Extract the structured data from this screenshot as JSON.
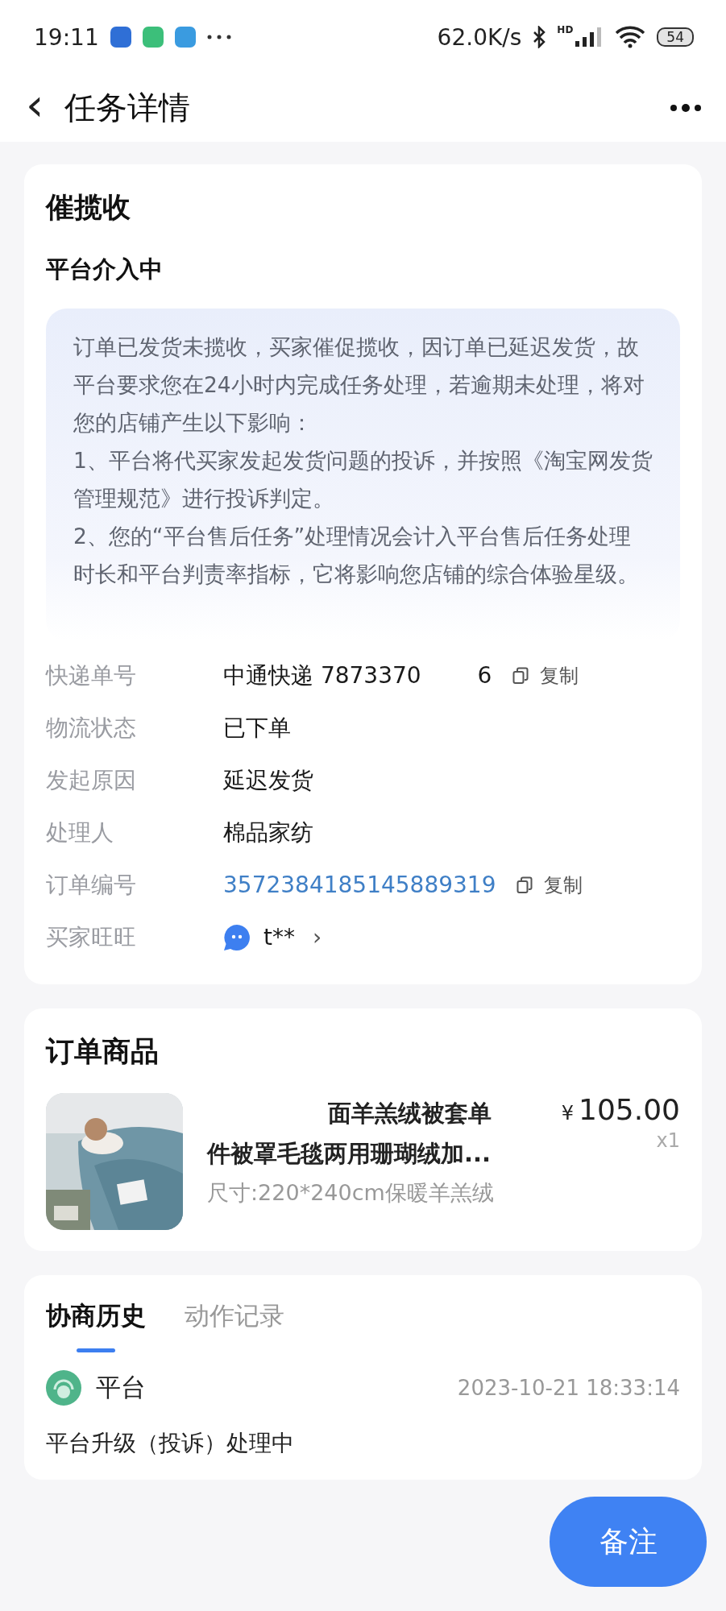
{
  "status_bar": {
    "time": "19:11",
    "speed": "62.0K/s",
    "network_label": "HD",
    "battery": "54"
  },
  "header": {
    "back": "‹",
    "title": "任务详情"
  },
  "task": {
    "title": "催揽收",
    "status": "平台介入中",
    "notice": [
      "订单已发货未揽收，买家催促揽收，因订单已延迟发货，故平台要求您在24小时内完成任务处理，若逾期未处理，将对您的店铺产生以下影响：",
      "1、平台将代买家发起发货问题的投诉，并按照《淘宝网发货管理规范》进行投诉判定。",
      "2、您的“平台售后任务”处理情况会计入平台售后任务处理时长和平台判责率指标，它将影响您店铺的综合体验星级。"
    ],
    "fields": [
      {
        "kind": "tracking",
        "label": "快递单号",
        "value": "中通快递 7873370",
        "value_tail": "6",
        "action": "复制"
      },
      {
        "kind": "text",
        "label": "物流状态",
        "value": "已下单"
      },
      {
        "kind": "text",
        "label": "发起原因",
        "value": "延迟发货"
      },
      {
        "kind": "text",
        "label": "处理人",
        "value": "棉品家纺"
      },
      {
        "kind": "link",
        "label": "订单编号",
        "value": "3572384185145889319",
        "action": "复制"
      },
      {
        "kind": "buyer",
        "label": "买家旺旺",
        "value": "t**",
        "arrow": "›"
      }
    ]
  },
  "goods": {
    "title": "订单商品",
    "item": {
      "kind": "picture",
      "title_lines": [
        "面羊羔绒被套单",
        "件被罩毛毯两用珊瑚绒加..."
      ],
      "spec": "尺寸:220*240cm保暖羊羔绒",
      "currency": "¥",
      "price": "105.00",
      "quantity": "x1"
    }
  },
  "history": {
    "tabs": [
      {
        "label": "协商历史",
        "selected": true
      },
      {
        "label": "动作记录",
        "selected": false
      }
    ],
    "entry": {
      "actor": "平台",
      "time": "2023-10-21 18:33:14",
      "text": "平台升级（投诉）处理中"
    }
  },
  "fab": {
    "label": "备注"
  }
}
